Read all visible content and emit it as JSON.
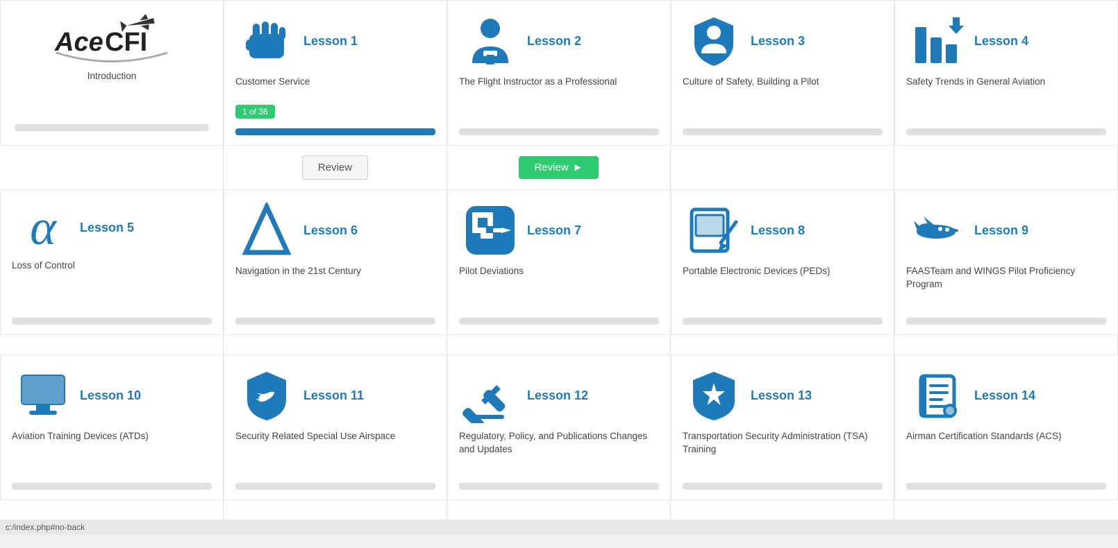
{
  "app": {
    "name": "AceCFI",
    "tagline": "Introduction",
    "status_bar": "c:/index.php#no-back"
  },
  "lessons": [
    {
      "id": "intro",
      "label": "",
      "title": "Introduction",
      "icon": "logo",
      "progress": 0,
      "badge": null
    },
    {
      "id": "lesson1",
      "label": "Lesson 1",
      "title": "Customer Service",
      "icon": "hand",
      "progress": 100,
      "badge": "1 of 36"
    },
    {
      "id": "lesson2",
      "label": "Lesson 2",
      "title": "The Flight Instructor as a Professional",
      "icon": "person",
      "progress": 0,
      "badge": null
    },
    {
      "id": "lesson3",
      "label": "Lesson 3",
      "title": "Culture of Safety, Building a Pilot",
      "icon": "shield-person",
      "progress": 0,
      "badge": null
    },
    {
      "id": "lesson4",
      "label": "Lesson 4",
      "title": "Safety Trends in General Aviation",
      "icon": "chart-down",
      "progress": 0,
      "badge": null
    },
    {
      "id": "lesson5",
      "label": "Lesson 5",
      "title": "Loss of Control",
      "icon": "alpha",
      "progress": 0,
      "badge": null
    },
    {
      "id": "lesson6",
      "label": "Lesson 6",
      "title": "Navigation in the 21st Century",
      "icon": "triangle",
      "progress": 0,
      "badge": null
    },
    {
      "id": "lesson7",
      "label": "Lesson 7",
      "title": "Pilot Deviations",
      "icon": "maze",
      "progress": 0,
      "badge": null
    },
    {
      "id": "lesson8",
      "label": "Lesson 8",
      "title": "Portable Electronic Devices (PEDs)",
      "icon": "tablet-pen",
      "progress": 0,
      "badge": null
    },
    {
      "id": "lesson9",
      "label": "Lesson 9",
      "title": "FAASTeam and WINGS Pilot Proficiency Program",
      "icon": "plane",
      "progress": 0,
      "badge": null
    },
    {
      "id": "lesson10",
      "label": "Lesson 10",
      "title": "Aviation Training Devices (ATDs)",
      "icon": "monitor",
      "progress": 0,
      "badge": null
    },
    {
      "id": "lesson11",
      "label": "Lesson 11",
      "title": "Security Related Special Use Airspace",
      "icon": "shield-plane",
      "progress": 0,
      "badge": null
    },
    {
      "id": "lesson12",
      "label": "Lesson 12",
      "title": "Regulatory, Policy, and Publications Changes and Updates",
      "icon": "gavel",
      "progress": 0,
      "badge": null
    },
    {
      "id": "lesson13",
      "label": "Lesson 13",
      "title": "Transportation Security Administration (TSA) Training",
      "icon": "badge-star",
      "progress": 0,
      "badge": null
    },
    {
      "id": "lesson14",
      "label": "Lesson 14",
      "title": "Airman Certification Standards (ACS)",
      "icon": "scroll",
      "progress": 0,
      "badge": null
    }
  ],
  "buttons": {
    "review": "Review",
    "review_green": "Review"
  }
}
